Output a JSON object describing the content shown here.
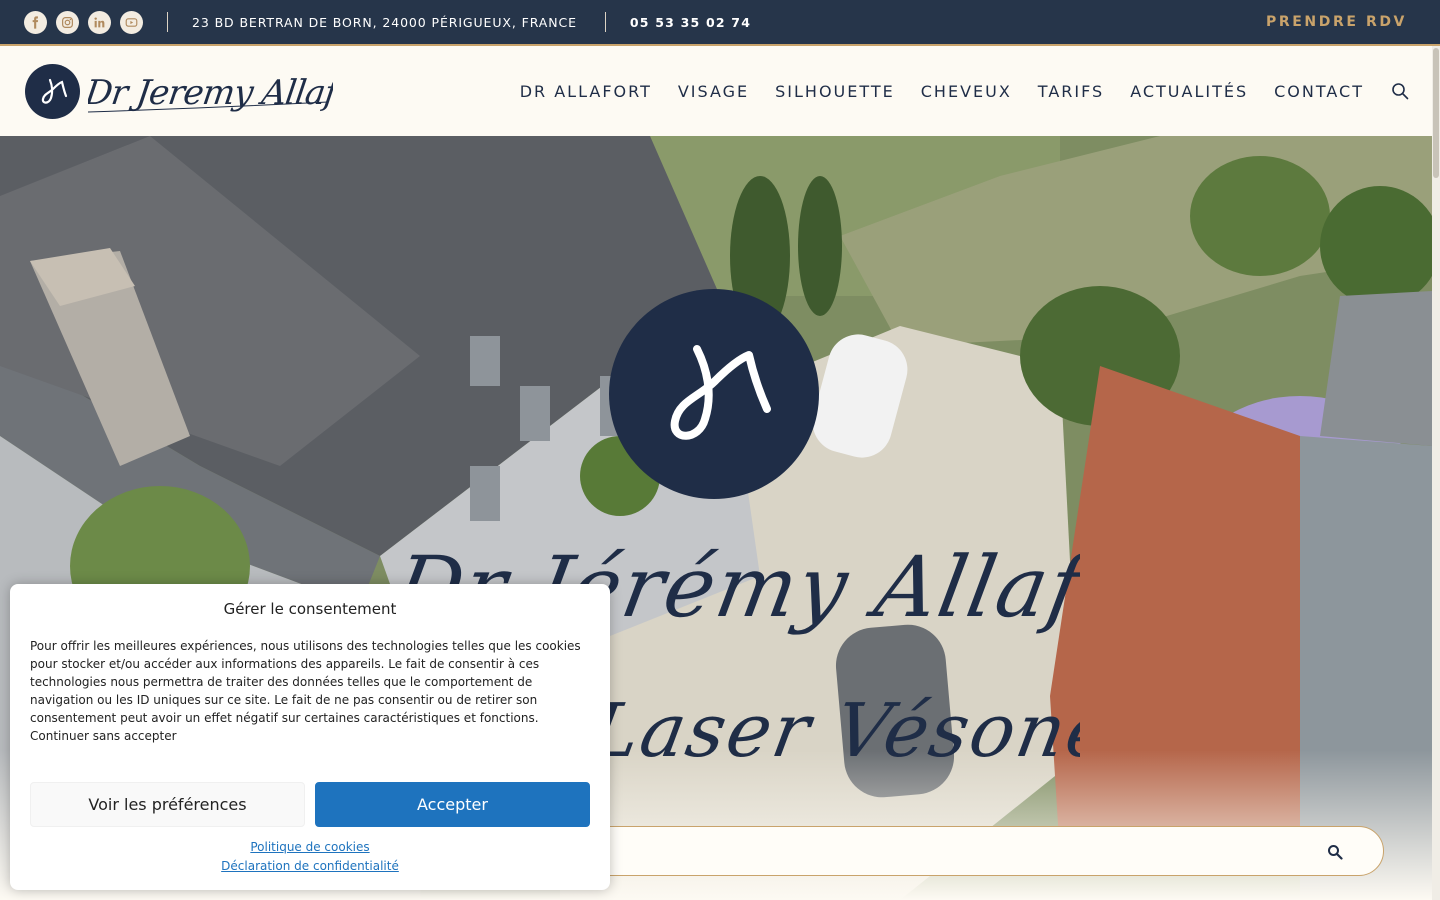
{
  "topbar": {
    "socials": [
      "facebook-icon",
      "instagram-icon",
      "linkedin-icon",
      "youtube-icon"
    ],
    "address": "23 BD BERTRAN DE BORN, 24000 PÉRIGUEUX, FRANCE",
    "phone": "05 53 35 02 74",
    "cta": "PRENDRE RDV"
  },
  "header": {
    "logo_text": "Dr Jeremy Allafort",
    "nav": [
      "DR ALLAFORT",
      "VISAGE",
      "SILHOUETTE",
      "CHEVEUX",
      "TARIFS",
      "ACTUALITÉS",
      "CONTACT"
    ]
  },
  "hero": {
    "line1": "Dr Jérémy Allafort",
    "line2": "Laser Vésone"
  },
  "consent": {
    "title": "Gérer le consentement",
    "body": "Pour offrir les meilleures expériences, nous utilisons des technologies telles que les cookies pour stocker et/ou accéder aux informations des appareils. Le fait de consentir à ces technologies nous permettra de traiter des données telles que le comportement de navigation ou les ID uniques sur ce site. Le fait de ne pas consentir ou de retirer son consentement peut avoir un effet négatif sur certaines caractéristiques et fonctions. Continuer sans accepter",
    "prefs_button": "Voir les préférences",
    "accept_button": "Accepter",
    "cookies_link": "Politique de cookies",
    "privacy_link": "Déclaration de confidentialité"
  },
  "colors": {
    "navy": "#1f2d47",
    "topbar": "#26354a",
    "gold": "#c9a36b",
    "accept_blue": "#1e73be"
  }
}
